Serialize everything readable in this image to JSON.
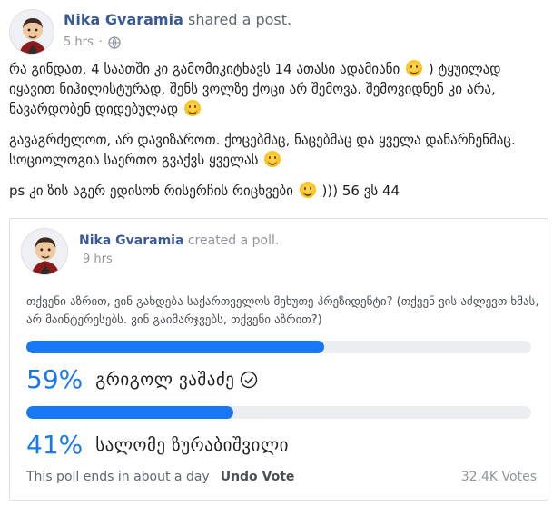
{
  "post": {
    "author": "Nika Gvaramia",
    "action": "shared a post.",
    "time": "5 hrs",
    "visibility_icon": "globe-icon",
    "body": {
      "p1_a": "რა გინდათ, 4 საათში კი გამომიკიტხავს 14 ათასი ადამიანი",
      "p1_b": ") ტყუილად იყავით ნიჰილისტურად, შენს ვოლზე ქოცი არ შემოვა. შემოვიდნენ კი არა, ნავარდობენ დიდებულად",
      "p2_a": "გავაგრძელოთ, არ დავიზაროთ. ქოცებმაც, ნაცებმაც და ყველა დანარჩენმაც. სოციოლოგია საერთო გვაქვს ყველას",
      "p3_a": "ps კი ზის აგერ ედისონ რისერჩის რიცხვები",
      "p3_b": "))) 56 ვს 44"
    }
  },
  "shared": {
    "author": "Nika Gvaramia",
    "action": "created a poll.",
    "time": "9 hrs",
    "question": "თქვენი აზრით, ვინ გახდება საქართველოს მეხუთე პრეზიდენტი? (თქვენ ვის აძლევთ ხმას, არ მაინტერესებს. ვინ გაიმარჯვებს, თქვენი აზრით?)",
    "options": [
      {
        "percent_label": "59%",
        "label": "გრიგოლ ვაშაძე",
        "share": 0.59,
        "voted": true
      },
      {
        "percent_label": "41%",
        "label": "სალომე ზურაბიშვილი",
        "share": 0.41,
        "voted": false
      }
    ],
    "footer": {
      "ends": "This poll ends in about a day",
      "undo": "Undo Vote",
      "votes": "32.4K Votes"
    }
  },
  "colors": {
    "accent": "#1877f2",
    "link": "#385898",
    "muted": "#90949c"
  }
}
